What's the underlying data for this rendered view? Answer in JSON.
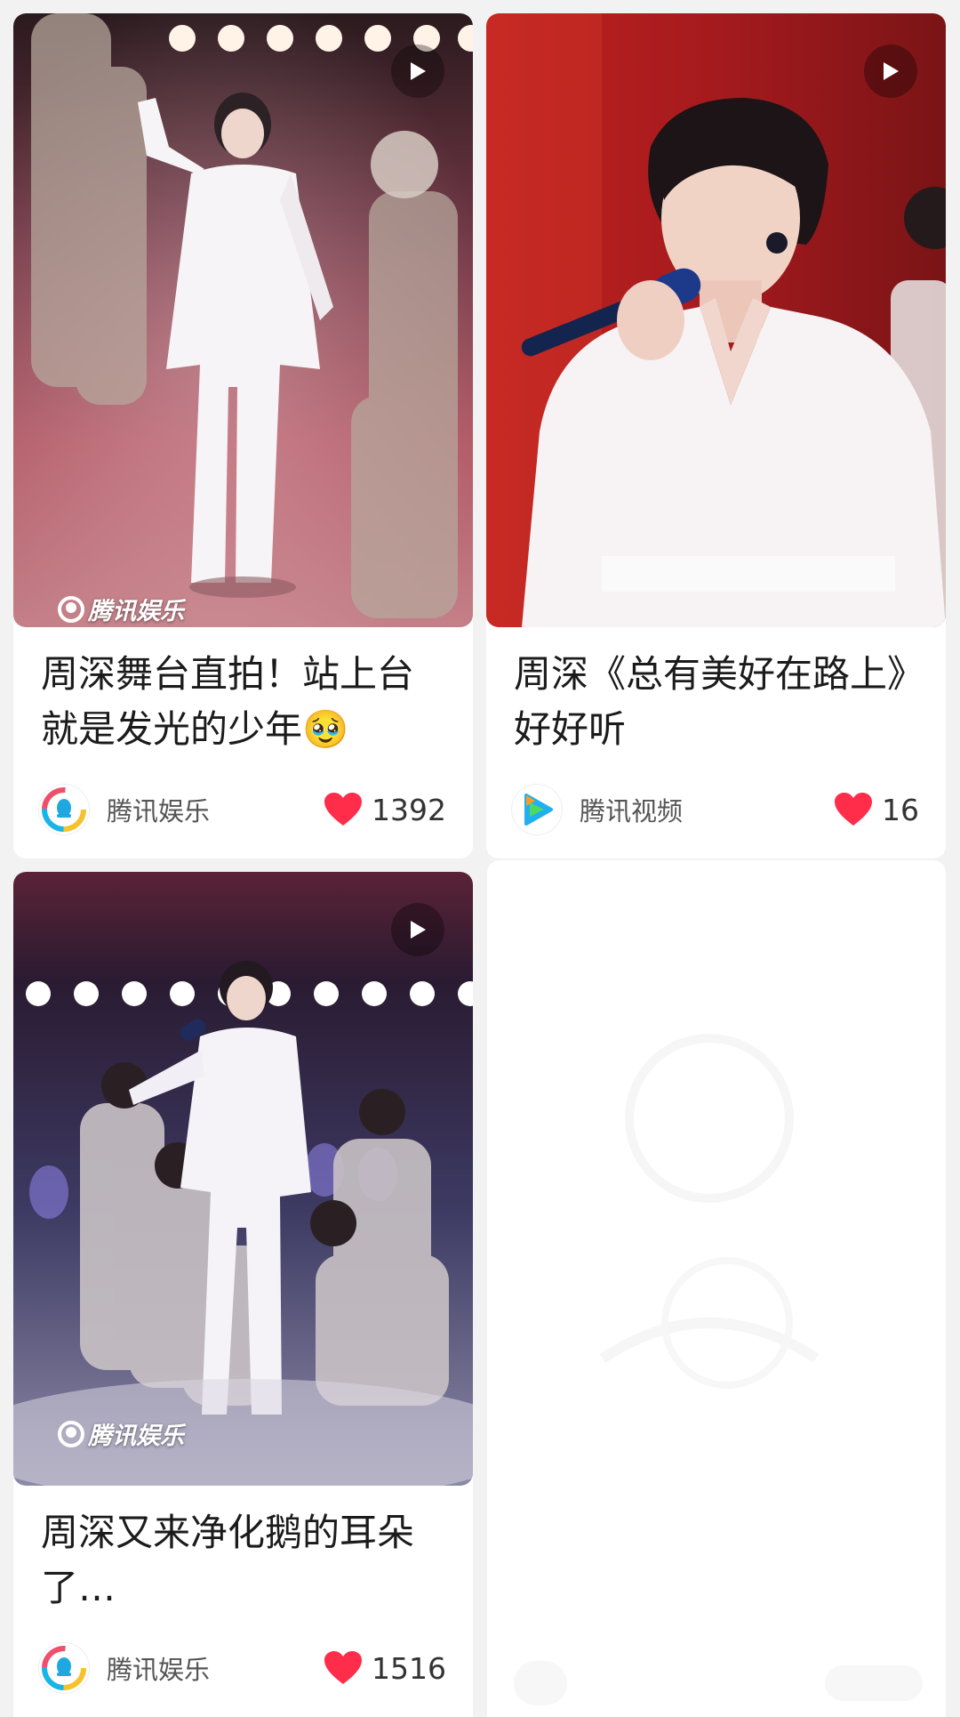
{
  "cards": [
    {
      "title": "周深舞台直拍！站上台就是发光的少年🥹",
      "watermark": "腾讯娱乐",
      "source": "腾讯娱乐",
      "source_icon": "tencent-entertainment-icon",
      "likes": "1392"
    },
    {
      "title": "周深《总有美好在路上》好好听",
      "watermark": "",
      "source": "腾讯视频",
      "source_icon": "tencent-video-icon",
      "likes": "16"
    },
    {
      "title": "周深又来净化鹅的耳朵了…",
      "watermark": "腾讯娱乐",
      "source": "腾讯娱乐",
      "source_icon": "tencent-entertainment-icon",
      "likes": "1516"
    }
  ],
  "colors": {
    "heart": "#ff2c4a",
    "title_text": "#1b1b1b",
    "source_text": "#555555"
  }
}
